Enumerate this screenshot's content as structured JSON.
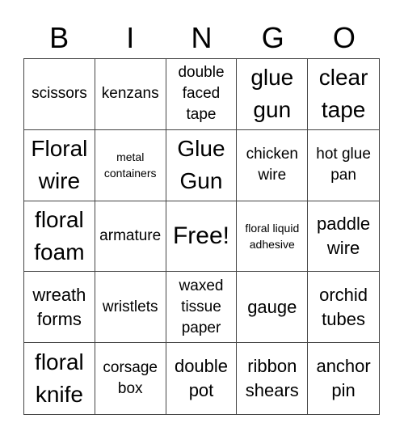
{
  "header": {
    "letters": [
      "B",
      "I",
      "N",
      "G",
      "O"
    ]
  },
  "cells": [
    {
      "text": "scissors",
      "size": "s-md"
    },
    {
      "text": "kenzans",
      "size": "s-md"
    },
    {
      "text": "double faced tape",
      "size": "s-md"
    },
    {
      "text": "glue gun",
      "size": "s-lg"
    },
    {
      "text": "clear tape",
      "size": "s-lg"
    },
    {
      "text": "Floral wire",
      "size": "s-lg"
    },
    {
      "text": "metal containers",
      "size": "s-sm"
    },
    {
      "text": "Glue Gun",
      "size": "s-lg"
    },
    {
      "text": "chicken wire",
      "size": "s-md"
    },
    {
      "text": "hot glue pan",
      "size": "s-md"
    },
    {
      "text": "floral foam",
      "size": "s-lg"
    },
    {
      "text": "armature",
      "size": "s-md"
    },
    {
      "text": "Free!",
      "size": "s-xl"
    },
    {
      "text": "floral liquid adhesive",
      "size": "s-sm"
    },
    {
      "text": "paddle wire",
      "size": "s-mdl"
    },
    {
      "text": "wreath forms",
      "size": "s-mdl"
    },
    {
      "text": "wristlets",
      "size": "s-md"
    },
    {
      "text": "waxed tissue paper",
      "size": "s-md"
    },
    {
      "text": "gauge",
      "size": "s-mdl"
    },
    {
      "text": "orchid tubes",
      "size": "s-mdl"
    },
    {
      "text": "floral knife",
      "size": "s-lg"
    },
    {
      "text": "corsage box",
      "size": "s-md"
    },
    {
      "text": "double pot",
      "size": "s-mdl"
    },
    {
      "text": "ribbon shears",
      "size": "s-mdl"
    },
    {
      "text": "anchor pin",
      "size": "s-mdl"
    }
  ]
}
